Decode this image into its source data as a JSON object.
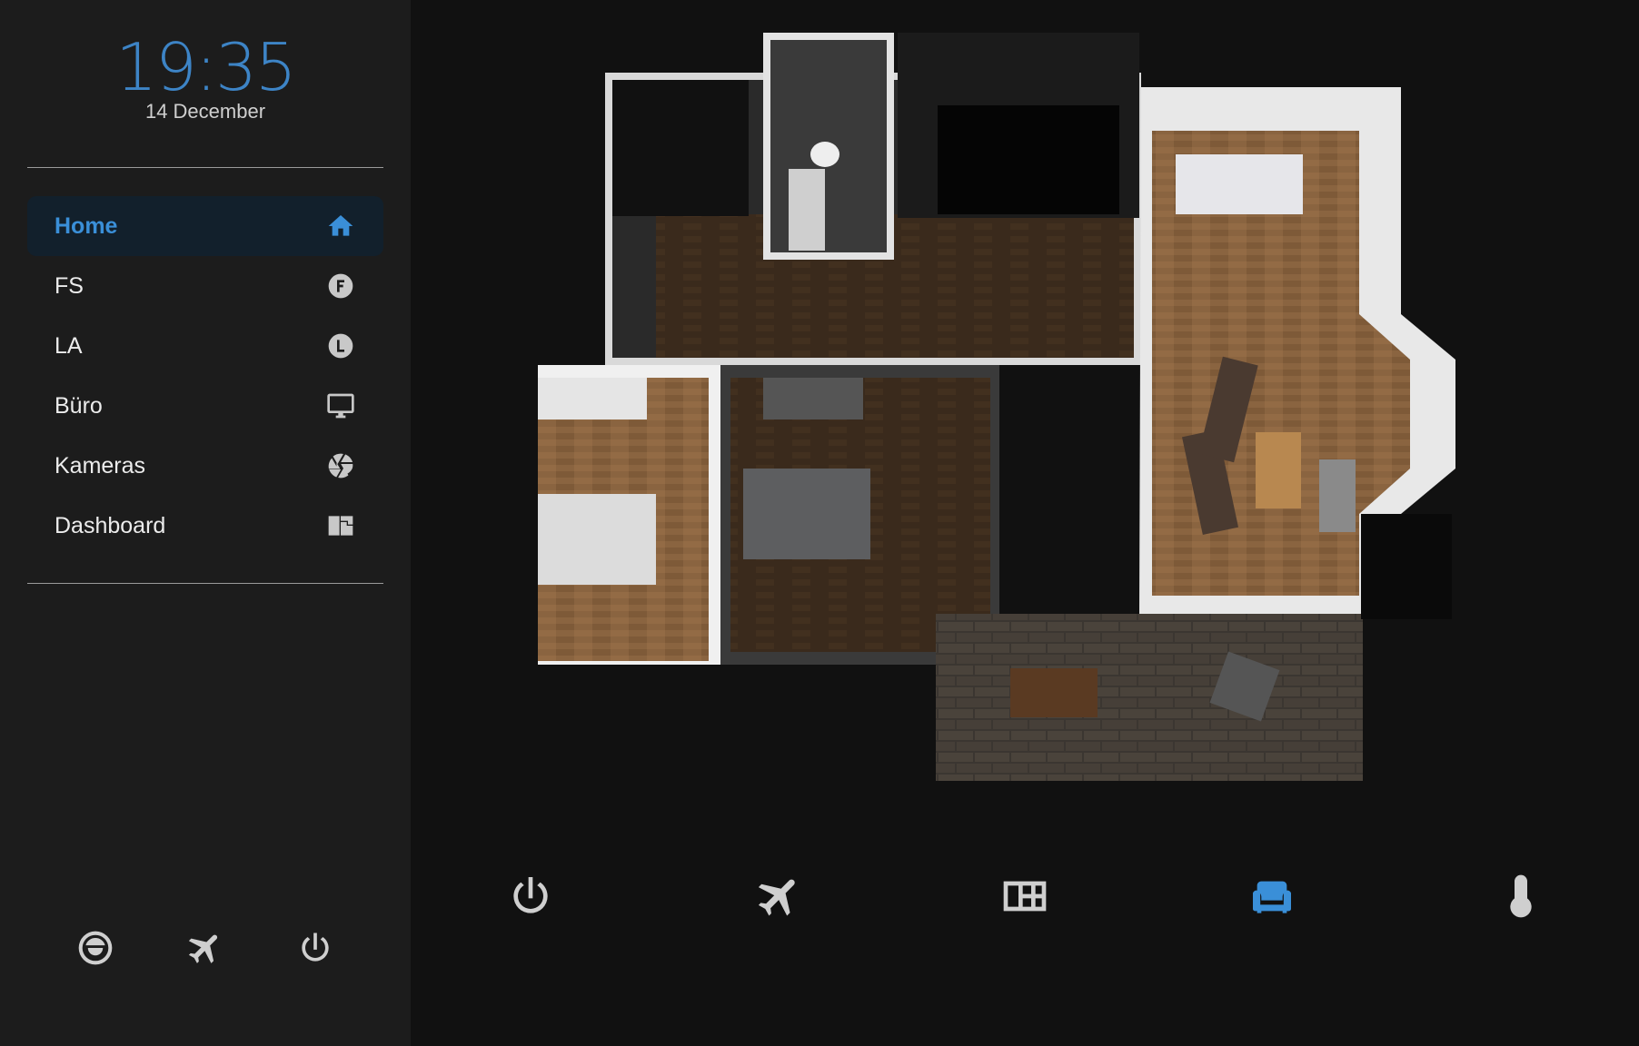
{
  "clock": {
    "time": "19:35",
    "date": "14 December"
  },
  "nav": {
    "items": [
      {
        "label": "Home",
        "icon": "home-icon",
        "active": true
      },
      {
        "label": "FS",
        "icon": "letter-f-circle-icon"
      },
      {
        "label": "LA",
        "icon": "letter-l-circle-icon"
      },
      {
        "label": "Büro",
        "icon": "monitor-icon"
      },
      {
        "label": "Kameras",
        "icon": "camera-iris-icon"
      },
      {
        "label": "Dashboard",
        "icon": "dashboard-icon"
      }
    ]
  },
  "sidebar_bottom": [
    "robot-vacuum-icon",
    "airplane-icon",
    "power-icon"
  ],
  "bottom_bar": {
    "buttons": [
      "power-icon",
      "airplane-icon",
      "floorplan-icon",
      "sofa-icon",
      "thermometer-icon"
    ],
    "active": "sofa-icon"
  },
  "colors": {
    "accent": "#3a8fd8",
    "sidebar_bg": "#1c1c1c",
    "page_bg": "#111111"
  }
}
